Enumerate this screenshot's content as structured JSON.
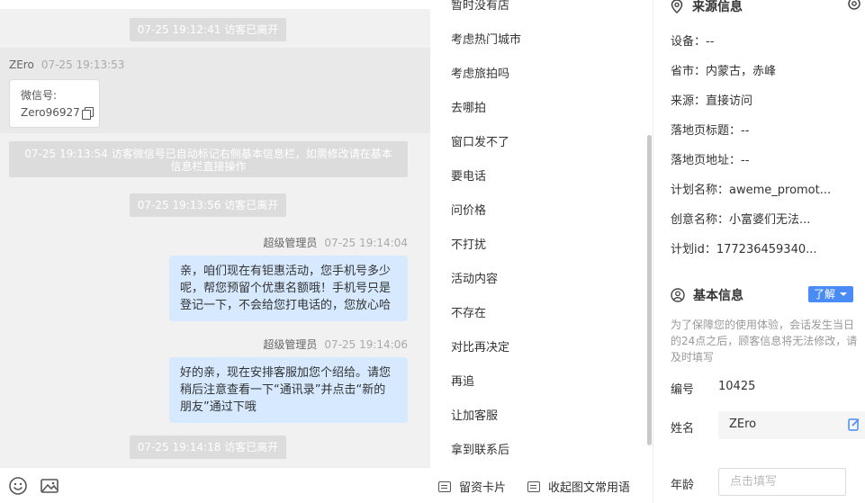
{
  "chat": {
    "sys1": "07-25 19:12:41 访客已离开",
    "visitor_name": "ZEro",
    "visitor_time": "07-25 19:13:53",
    "card_label": "微信号:",
    "card_value": "Zero96927",
    "sys2": "07-25 19:13:54 访客微信号已自动标记右侧基本信息栏，如需修改请在基本信息栏直接操作",
    "sys3": "07-25 19:13:56 访客已离开",
    "agent1_name": "超级管理员",
    "agent1_time": "07-25 19:14:04",
    "agent1_text": "亲，咱们现在有钜惠活动，您手机号多少呢，帮您预留个优惠名额哦！手机号只是登记一下，不会给您打电话的，您放心哈",
    "agent2_name": "超级管理员",
    "agent2_time": "07-25 19:14:06",
    "agent2_text": "好的亲，现在安排客服加您个绍给。请您稍后注意查看一下“通讯录”并点击“新的朋友”通过下哦",
    "sys4": "07-25 19:14:18 访客已离开",
    "toolbar_icons": [
      "emoji-icon",
      "image-icon"
    ]
  },
  "quick_replies": {
    "items": [
      "暂时没有店",
      "考虑热门城市",
      "考虑旅拍吗",
      "去哪拍",
      "窗口发不了",
      "要电话",
      "问价格",
      "不打扰",
      "活动内容",
      "不存在",
      "对比再决定",
      "再追",
      "让加客服",
      "拿到联系后"
    ],
    "footer_card": "留资卡片",
    "footer_collapse": "收起图文常用语"
  },
  "source_info": {
    "title": "来源信息",
    "device": "设备：--",
    "region": "省市：内蒙古，赤峰",
    "source": "来源：直接访问",
    "landing_title": "落地页标题：--",
    "landing_url": "落地页地址：--",
    "plan_name": "计划名称：aweme_promot...",
    "creative_name": "创意名称：小富婆们无法...",
    "plan_id": "计划id：177236459340..."
  },
  "basic_info": {
    "title": "基本信息",
    "learn_more": "了解",
    "hint": "为了保障您的使用体验，会话发生当日的24点之后，顾客信息将无法修改，请及时填写",
    "id_label": "编号",
    "id_value": "10425",
    "name_label": "姓名",
    "name_value": "ZEro",
    "age_label": "年龄",
    "age_placeholder": "点击填写"
  },
  "colors": {
    "accent": "#4a8cf7",
    "agent_bubble": "#d6e9ff",
    "chat_bg": "#f1f1f1"
  }
}
